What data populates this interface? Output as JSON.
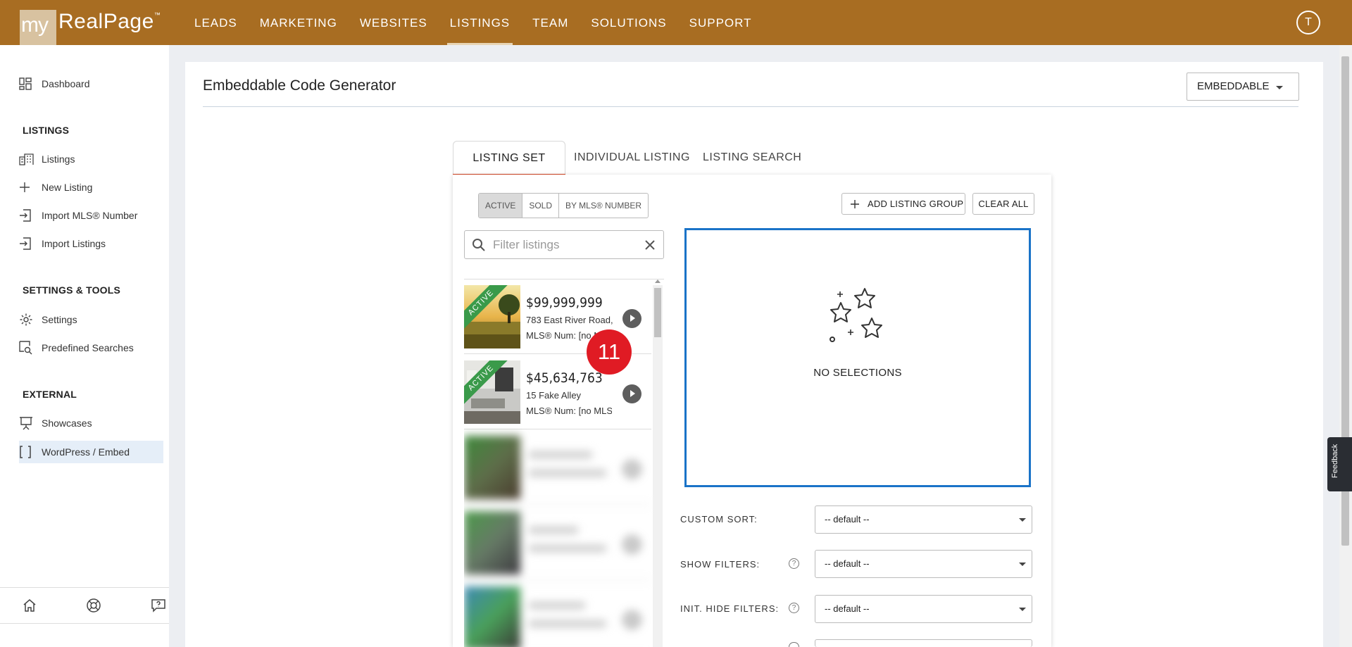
{
  "brand": {
    "my": "my",
    "name": "RealPage",
    "tm": "™"
  },
  "nav": [
    {
      "label": "LEADS"
    },
    {
      "label": "MARKETING"
    },
    {
      "label": "WEBSITES"
    },
    {
      "label": "LISTINGS",
      "active": true
    },
    {
      "label": "TEAM"
    },
    {
      "label": "SOLUTIONS"
    },
    {
      "label": "SUPPORT"
    }
  ],
  "user": {
    "initial": "T"
  },
  "sidebar": {
    "dashboard": "Dashboard",
    "listings_heading": "LISTINGS",
    "listings": "Listings",
    "new_listing": "New Listing",
    "import_mls": "Import MLS® Number",
    "import_listings": "Import Listings",
    "settings_heading": "SETTINGS & TOOLS",
    "settings": "Settings",
    "predefined": "Predefined Searches",
    "external_heading": "EXTERNAL",
    "showcases": "Showcases",
    "wordpress": "WordPress / Embed"
  },
  "page": {
    "title": "Embeddable Code Generator",
    "mode_button": "EMBEDDABLE"
  },
  "tabs": [
    {
      "label": "LISTING SET",
      "active": true
    },
    {
      "label": "INDIVIDUAL LISTING"
    },
    {
      "label": "LISTING SEARCH"
    }
  ],
  "status_filter": [
    "ACTIVE",
    "SOLD",
    "BY MLS® NUMBER"
  ],
  "actions": {
    "add_group": "ADD LISTING GROUP",
    "clear_all": "CLEAR ALL"
  },
  "filter": {
    "placeholder": "Filter listings"
  },
  "listings": [
    {
      "badge": "ACTIVE",
      "price": "$99,999,999",
      "address": "783 East River Road,",
      "mls": "MLS® Num: [no MLS"
    },
    {
      "badge": "ACTIVE",
      "price": "$45,634,763",
      "address": "15 Fake Alley",
      "mls": "MLS® Num: [no MLS"
    }
  ],
  "overlay_badge": "11",
  "selection": {
    "empty_text": "NO SELECTIONS"
  },
  "options": [
    {
      "label": "CUSTOM SORT:",
      "value": "-- default --",
      "help": false
    },
    {
      "label": "SHOW FILTERS:",
      "value": "-- default --",
      "help": true
    },
    {
      "label": "INIT. HIDE FILTERS:",
      "value": "-- default --",
      "help": true
    }
  ],
  "feedback": "Feedback",
  "colors": {
    "topbar": "#a86d22",
    "active_tab": "#d2421e",
    "selection_border": "#1a73c8",
    "badge": "#e01b24",
    "ribbon": "#3a9a4a"
  }
}
